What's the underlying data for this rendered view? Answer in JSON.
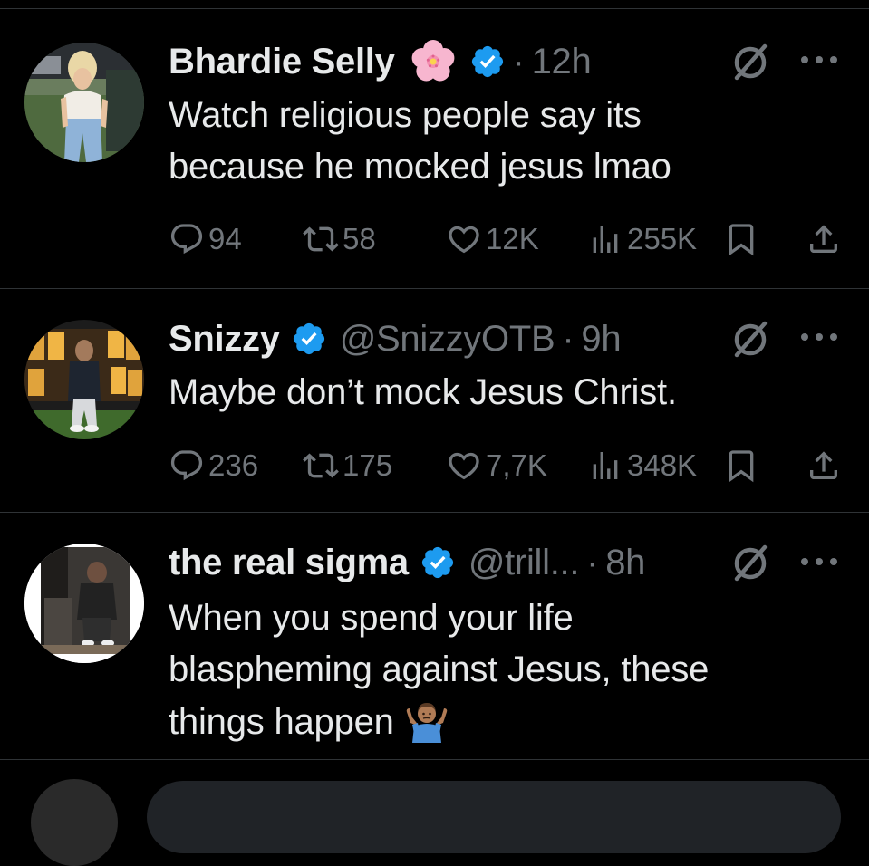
{
  "tweets": [
    {
      "name": "Bhardie Selly",
      "handle": "",
      "dot": "·",
      "time": "12h",
      "text_lines": [
        "Watch religious people say its",
        "because he mocked jesus lmao"
      ],
      "replies": "94",
      "reposts": "58",
      "likes": "12K",
      "views": "255K",
      "name_emoji": "cherry-blossom-icon"
    },
    {
      "name": "Snizzy",
      "handle": "@SnizzyOTB",
      "dot": "·",
      "time": "9h",
      "text_lines": [
        "Maybe don’t mock Jesus Christ."
      ],
      "replies": "236",
      "reposts": "175",
      "likes": "7,7K",
      "views": "348K"
    },
    {
      "name": "the real sigma",
      "handle": "@trill...",
      "dot": "·",
      "time": "8h",
      "text_lines": [
        "When you spend your life",
        "blaspheming against Jesus, these",
        "things happen"
      ],
      "text_emoji": "person-shrugging-icon"
    }
  ],
  "colors": {
    "background": "#000000",
    "text": "#e7e9ea",
    "muted": "#71767b",
    "divider": "#2f3336",
    "verified": "#1d9bf0"
  }
}
